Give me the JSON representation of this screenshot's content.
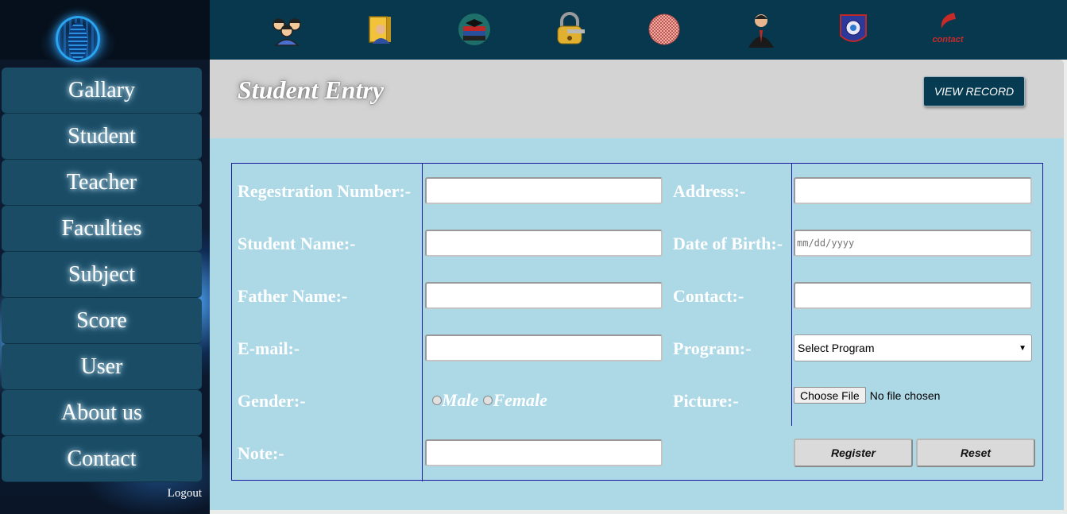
{
  "sidebar": {
    "logo": "globe-logo",
    "items": [
      {
        "label": "Gallary"
      },
      {
        "label": "Student"
      },
      {
        "label": "Teacher"
      },
      {
        "label": "Faculties"
      },
      {
        "label": "Subject"
      },
      {
        "label": "Score"
      },
      {
        "label": "User"
      },
      {
        "label": "About us"
      },
      {
        "label": "Contact"
      }
    ],
    "logout": "Logout"
  },
  "topbar": {
    "icons": [
      "students-group-icon",
      "teacher-book-icon",
      "books-globe-icon",
      "lock-key-icon",
      "ball-icon",
      "person-suit-icon",
      "shield-badge-icon",
      "contact-logo-icon"
    ],
    "contact_word": "contact"
  },
  "page": {
    "title": "Student Entry",
    "view_record": "VIEW RECORD"
  },
  "form": {
    "reg_label": "Regestration Number:-",
    "name_label": "Student Name:-",
    "father_label": "Father Name:-",
    "email_label": "E-mail:-",
    "gender_label": "Gender:-",
    "note_label": "Note:-",
    "address_label": "Address:-",
    "dob_label": "Date of Birth:-",
    "contact_label": "Contact:-",
    "program_label": "Program:-",
    "picture_label": "Picture:-",
    "dob_placeholder": "mm/dd/yyyy",
    "gender_options": [
      "Male",
      "Female"
    ],
    "program_selected": "Select Program",
    "file_button": "Choose File",
    "file_status": "No file chosen",
    "register": "Register",
    "reset": "Reset"
  },
  "colors": {
    "sidebar_item": "#1a4c66",
    "topbar": "#07384d",
    "form_bg": "#add8e6",
    "heading_bg": "#d3d3d3",
    "border": "#1a1aa0"
  }
}
